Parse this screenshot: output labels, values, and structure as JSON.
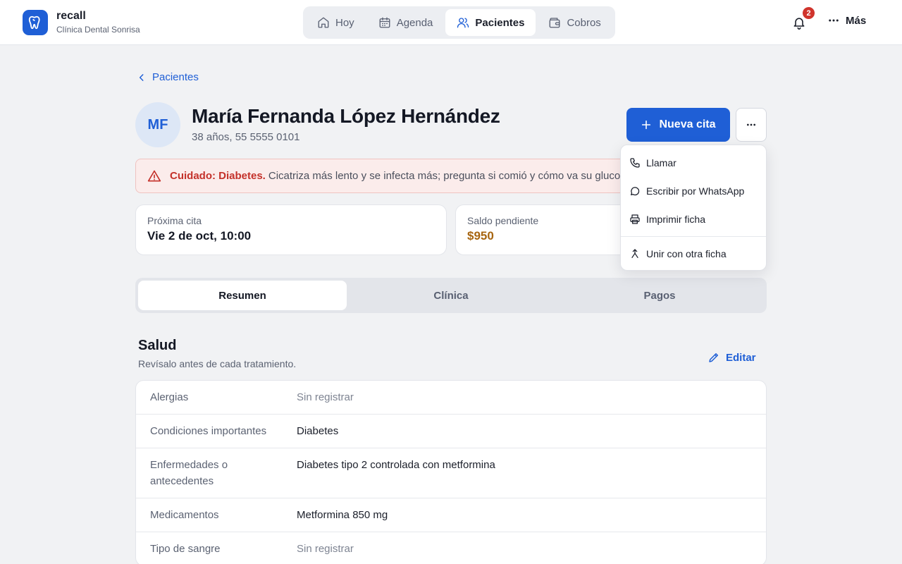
{
  "brand": {
    "name": "recall",
    "clinic": "Clínica Dental Sonrisa"
  },
  "nav": {
    "tabs": [
      {
        "label": "Hoy",
        "icon": "home-icon"
      },
      {
        "label": "Agenda",
        "icon": "calendar-icon"
      },
      {
        "label": "Pacientes",
        "icon": "users-icon",
        "active": true
      },
      {
        "label": "Cobros",
        "icon": "wallet-icon"
      }
    ],
    "notifications_count": "2",
    "more_label": "Más"
  },
  "back_label": "Pacientes",
  "patient": {
    "initials": "MF",
    "name": "María Fernanda López Hernández",
    "meta": "38 años, 55 5555 0101"
  },
  "actions": {
    "new_appointment": "Nueva cita"
  },
  "alert": {
    "title": "Cuidado: Diabetes.",
    "text": "Cicatriza más lento y se infecta más; pregunta si comió y cómo va su glucosa."
  },
  "cards": {
    "next": {
      "label": "Próxima cita",
      "value": "Vie 2 de oct, 10:00"
    },
    "balance": {
      "label": "Saldo pendiente",
      "value": "$950"
    }
  },
  "tabs": [
    "Resumen",
    "Clínica",
    "Pagos"
  ],
  "health": {
    "title": "Salud",
    "subtitle": "Revísalo antes de cada tratamiento.",
    "edit_label": "Editar",
    "rows": [
      {
        "label": "Alergias",
        "value": "Sin registrar"
      },
      {
        "label": "Condiciones importantes",
        "value": "Diabetes"
      },
      {
        "label": "Enfermedades o antecedentes",
        "value": "Diabetes tipo 2 controlada con metformina"
      },
      {
        "label": "Medicamentos",
        "value": "Metformina 850 mg"
      },
      {
        "label": "Tipo de sangre",
        "value": "Sin registrar"
      }
    ]
  },
  "menu": {
    "call": "Llamar",
    "whatsapp": "Escribir por WhatsApp",
    "print": "Imprimir ficha",
    "merge": "Unir con otra ficha"
  },
  "colors": {
    "primary": "#1f5fd6",
    "danger": "#c4312a",
    "money": "#a76510"
  }
}
